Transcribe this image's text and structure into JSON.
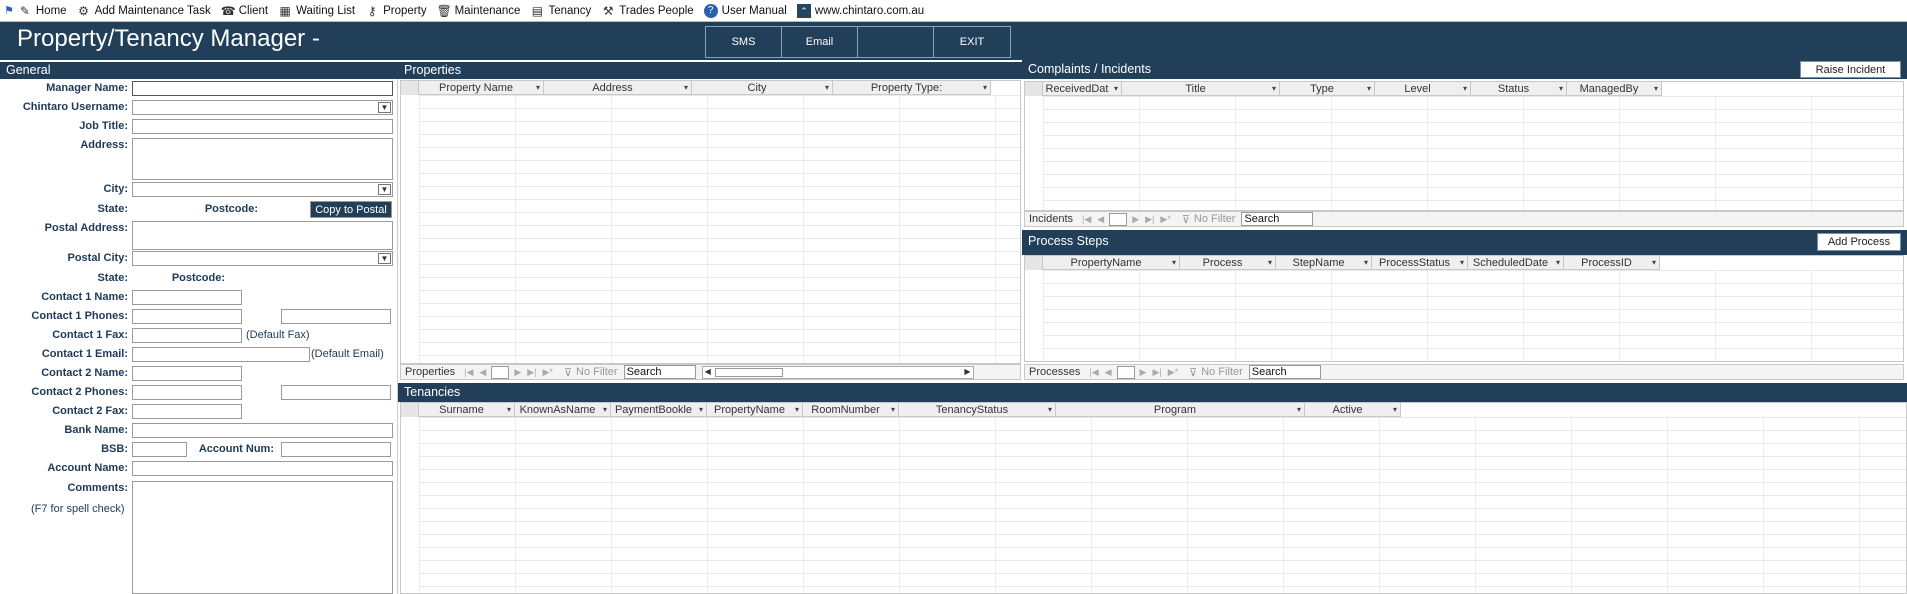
{
  "toolbar": {
    "items": [
      {
        "label": "Home",
        "icon": "home-icon"
      },
      {
        "label": "Add Maintenance Task",
        "icon": "tools-icon"
      },
      {
        "label": "Client",
        "icon": "client-icon"
      },
      {
        "label": "Waiting List",
        "icon": "table-icon"
      },
      {
        "label": "Property",
        "icon": "key-icon"
      },
      {
        "label": "Maintenance",
        "icon": "trash-icon"
      },
      {
        "label": "Tenancy",
        "icon": "calculator-icon"
      },
      {
        "label": "Trades People",
        "icon": "runner-icon"
      },
      {
        "label": "User Manual",
        "icon": "help-icon"
      },
      {
        "label": "www.chintaro.com.au",
        "icon": "chintaro-logo-icon"
      }
    ]
  },
  "header": {
    "title": "Property/Tenancy Manager -",
    "buttons": {
      "sms": "SMS",
      "email": "Email",
      "blank": "",
      "exit": "EXIT"
    }
  },
  "general": {
    "heading": "General",
    "labels": {
      "manager_name": "Manager Name:",
      "username": "Chintaro Username:",
      "job_title": "Job Title:",
      "address": "Address:",
      "city": "City:",
      "state": "State:",
      "postcode": "Postcode:",
      "postal_address": "Postal Address:",
      "postal_city": "Postal City:",
      "postal_state": "State:",
      "postal_postcode": "Postcode:",
      "contact1_name": "Contact 1 Name:",
      "contact1_phones": "Contact 1 Phones:",
      "contact1_fax": "Contact 1 Fax:",
      "contact1_email": "Contact 1 Email:",
      "contact2_name": "Contact 2 Name:",
      "contact2_phones": "Contact 2 Phones:",
      "contact2_fax": "Contact 2 Fax:",
      "bank_name": "Bank Name:",
      "bsb": "BSB:",
      "account_num": "Account Num:",
      "account_name": "Account Name:",
      "comments": "Comments:"
    },
    "notes": {
      "default_fax": "(Default Fax)",
      "default_email": "(Default Email)",
      "spell_check": "(F7 for spell check)"
    },
    "copy_button": "Copy to Postal"
  },
  "properties": {
    "heading": "Properties",
    "columns": [
      "Property Name",
      "Address",
      "City",
      "Property Type:"
    ],
    "nav": {
      "label": "Properties",
      "filter": "No Filter",
      "search": "Search"
    }
  },
  "complaints": {
    "heading": "Complaints / Incidents",
    "button": "Raise Incident",
    "columns": [
      "ReceivedDat",
      "Title",
      "Type",
      "Level",
      "Status",
      "ManagedBy"
    ],
    "nav": {
      "label": "Incidents",
      "filter": "No Filter",
      "search": "Search"
    }
  },
  "process_steps": {
    "heading": "Process Steps",
    "button": "Add Process",
    "columns": [
      "PropertyName",
      "Process",
      "StepName",
      "ProcessStatus",
      "ScheduledDate",
      "ProcessID"
    ],
    "nav": {
      "label": "Processes",
      "filter": "No Filter",
      "search": "Search"
    }
  },
  "tenancies": {
    "heading": "Tenancies",
    "columns": [
      "Surname",
      "KnownAsName",
      "PaymentBookle",
      "PropertyName",
      "RoomNumber",
      "TenancyStatus",
      "Program",
      "Active"
    ]
  }
}
